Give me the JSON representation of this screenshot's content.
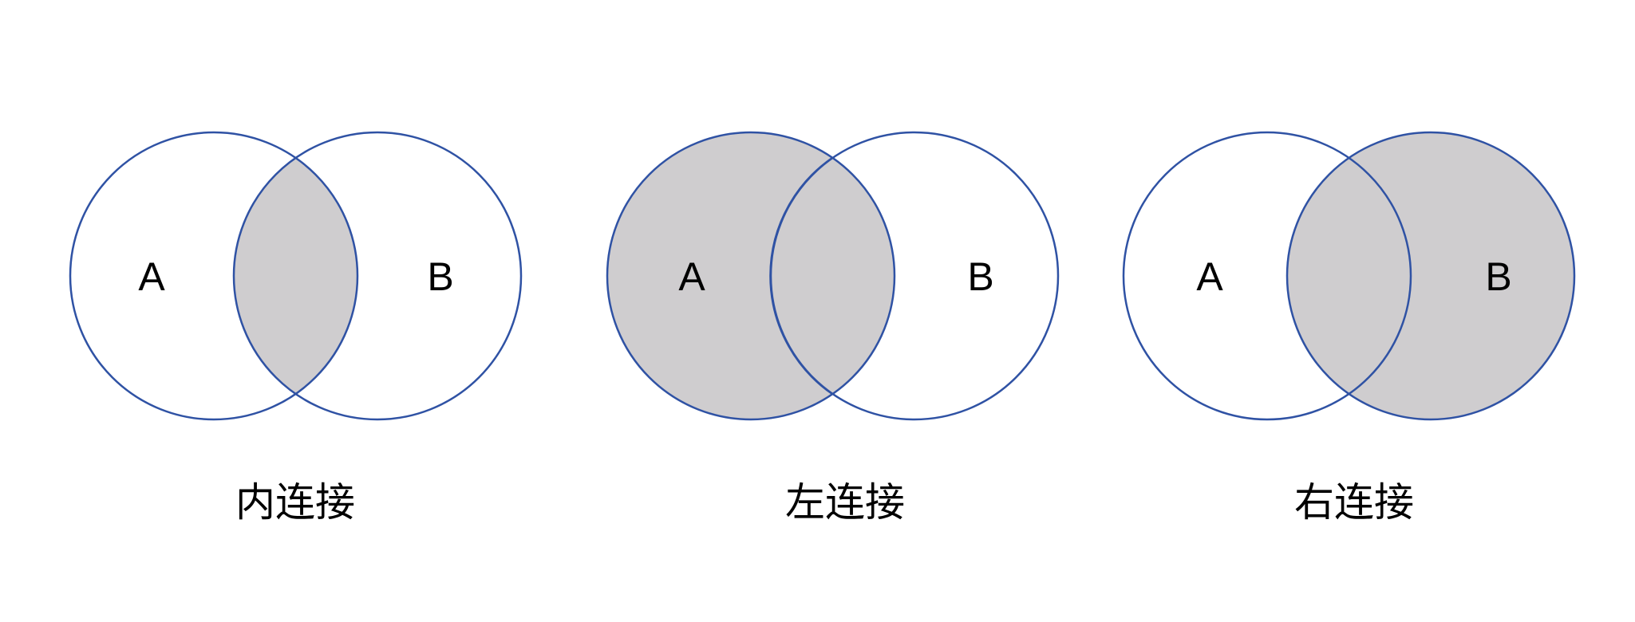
{
  "colors": {
    "outline": "#2f52a4",
    "fill": "#cfcdcf",
    "background": "#ffffff",
    "text": "#000000"
  },
  "diagrams": [
    {
      "caption": "内连接",
      "set_a": "A",
      "set_b": "B",
      "shaded": "intersection"
    },
    {
      "caption": "左连接",
      "set_a": "A",
      "set_b": "B",
      "shaded": "left"
    },
    {
      "caption": "右连接",
      "set_a": "A",
      "set_b": "B",
      "shaded": "right"
    }
  ]
}
